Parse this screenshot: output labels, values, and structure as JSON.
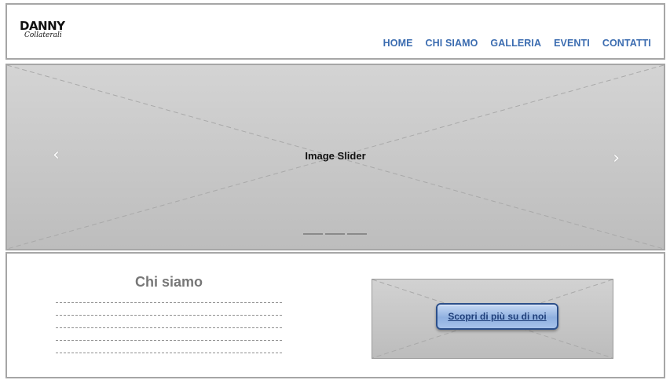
{
  "header": {
    "logo": {
      "line1": "DANNY",
      "line2": "Collaterali"
    },
    "nav": [
      {
        "label": "HOME"
      },
      {
        "label": "CHI SIAMO"
      },
      {
        "label": "GALLERIA"
      },
      {
        "label": "EVENTI"
      },
      {
        "label": "CONTATTI"
      }
    ]
  },
  "slider": {
    "label": "Image Slider",
    "prev_icon": "chevron-left",
    "next_icon": "chevron-right",
    "prev_glyph": "‹",
    "next_glyph": "›",
    "indicator_count": 3
  },
  "about": {
    "title": "Chi siamo",
    "placeholder_line_count": 5,
    "button_label": "Scopri di più su di noi"
  },
  "colors": {
    "nav_link": "#3b6cb0",
    "placeholder_gray": "#c8c8c8",
    "button_blue": "#8fb0e0",
    "border": "#a6a6a6"
  }
}
